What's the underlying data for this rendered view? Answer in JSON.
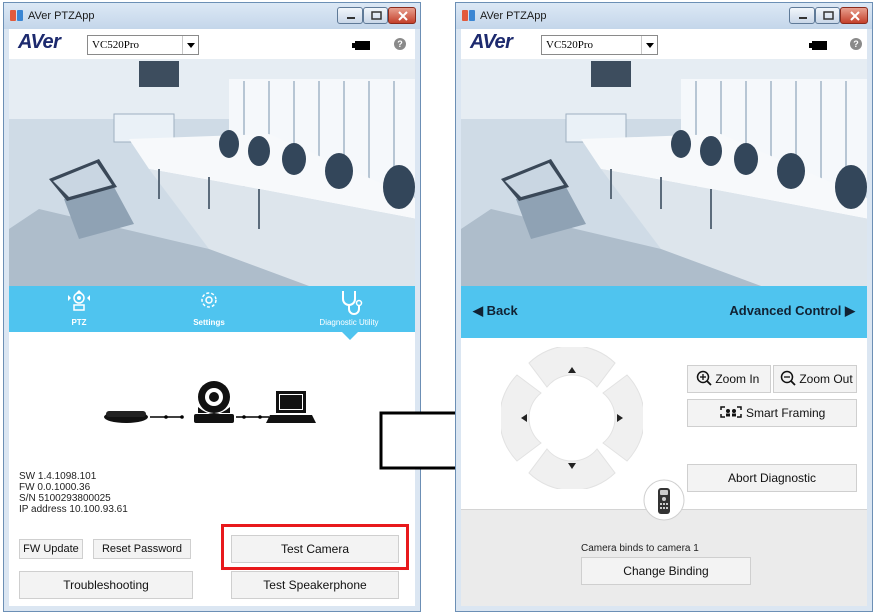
{
  "app": {
    "title": "AVer PTZApp",
    "logo": "AVer",
    "model": "VC520Pro"
  },
  "window1": {
    "nav": {
      "ptz": "PTZ",
      "settings": "Settings",
      "diagnostic": "Diagnostic Utility"
    },
    "info": {
      "sw": "SW 1.4.1098.101",
      "fw": "FW 0.0.1000.36",
      "sn": "S/N 5100293800025",
      "ip": "IP address 10.100.93.61"
    },
    "buttons": {
      "fw_update": "FW Update",
      "reset_password": "Reset Password",
      "test_camera": "Test Camera",
      "troubleshooting": "Troubleshooting",
      "test_speakerphone": "Test Speakerphone"
    }
  },
  "window2": {
    "back": "Back",
    "advanced_control": "Advanced Control",
    "zoom_in": "Zoom In",
    "zoom_out": "Zoom Out",
    "smart_framing": "Smart Framing",
    "abort_diagnostic": "Abort Diagnostic",
    "camera_binds": "Camera binds to camera 1",
    "change_binding": "Change Binding"
  },
  "colors": {
    "accent": "#4fc4ef",
    "highlight": "#e8191c",
    "logo": "#1d2a6e"
  },
  "icons": [
    "minimize-icon",
    "maximize-icon",
    "close-icon",
    "battery-icon",
    "help-icon",
    "ptz-icon",
    "settings-gear-icon",
    "stethoscope-icon",
    "camera-icon",
    "laptop-icon",
    "speakerphone-icon",
    "remote-control-icon",
    "zoom-in-icon",
    "zoom-out-icon",
    "smart-framing-icon",
    "arrow-right-icon"
  ]
}
